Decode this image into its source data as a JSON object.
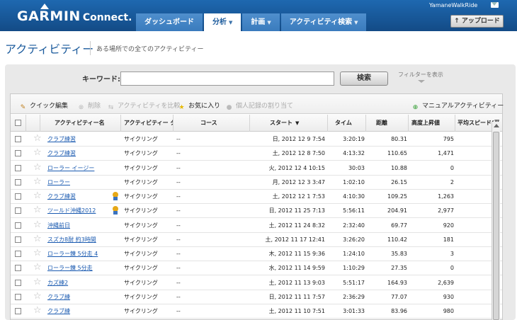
{
  "header": {
    "brand": "GARMIN",
    "brand_sub": "Connect.",
    "user_name": "YamaneWalkRide",
    "upload_label": "アップロード",
    "nav": [
      {
        "label": "ダッシュボード",
        "caret": ""
      },
      {
        "label": "分析",
        "caret": "▼"
      },
      {
        "label": "計画",
        "caret": "▼"
      },
      {
        "label": "アクティビティ検索",
        "caret": "▼"
      }
    ]
  },
  "page": {
    "title": "アクティビティー",
    "subtitle": "ある場所での全てのアクティビティー"
  },
  "search": {
    "keyword_label": "キーワード:",
    "keyword_value": "",
    "search_button": "検索",
    "filter_label": "フィルターを表示"
  },
  "toolbar": {
    "quick_edit": "クイック編集",
    "delete": "削除",
    "compare": "アクティビティを比較",
    "favorite": "お気に入り",
    "personal_record": "個人記録の割り当て",
    "manual_activity": "マニュアルアクティビティー"
  },
  "columns": {
    "name": "アクティビティー名",
    "type": "アクティビティー タ",
    "course": "コース",
    "start": "スタート",
    "start_sort": "▼",
    "time": "タイム",
    "distance": "距離",
    "elevation": "高度上昇値",
    "avg_speed": "平均スピード(平"
  },
  "rows": [
    {
      "name": "クラブ練習",
      "medal": false,
      "type": "サイクリング",
      "course": "--",
      "start": "日, 2012 12 9 7:54",
      "time": "3:20:19",
      "distance": "80.31",
      "elevation": "795"
    },
    {
      "name": "クラブ練習",
      "medal": false,
      "type": "サイクリング",
      "course": "--",
      "start": "土, 2012 12 8 7:50",
      "time": "4:13:32",
      "distance": "110.65",
      "elevation": "1,471"
    },
    {
      "name": "ローラー イージー",
      "medal": false,
      "type": "サイクリング",
      "course": "--",
      "start": "火, 2012 12 4 10:15",
      "time": "30:03",
      "distance": "10.88",
      "elevation": "0"
    },
    {
      "name": "ローラー",
      "medal": false,
      "type": "サイクリング",
      "course": "--",
      "start": "月, 2012 12 3 3:47",
      "time": "1:02:10",
      "distance": "26.15",
      "elevation": "2"
    },
    {
      "name": "クラブ練習",
      "medal": true,
      "type": "サイクリング",
      "course": "--",
      "start": "土, 2012 12 1 7:53",
      "time": "4:10:30",
      "distance": "109.25",
      "elevation": "1,263"
    },
    {
      "name": "ツールド沖縄2012",
      "medal": true,
      "type": "サイクリング",
      "course": "--",
      "start": "日, 2012 11 25 7:13",
      "time": "5:56:11",
      "distance": "204.91",
      "elevation": "2,977"
    },
    {
      "name": "沖縄前日",
      "medal": false,
      "type": "サイクリング",
      "course": "--",
      "start": "土, 2012 11 24 8:32",
      "time": "2:32:40",
      "distance": "69.77",
      "elevation": "920"
    },
    {
      "name": "スズカ8耐 約3時間",
      "medal": false,
      "type": "サイクリング",
      "course": "--",
      "start": "土, 2012 11 17 12:41",
      "time": "3:26:20",
      "distance": "110.42",
      "elevation": "181"
    },
    {
      "name": "ローラー錬 5分走 4",
      "medal": false,
      "type": "サイクリング",
      "course": "--",
      "start": "木, 2012 11 15 9:36",
      "time": "1:24:10",
      "distance": "35.83",
      "elevation": "3"
    },
    {
      "name": "ローラー錬 5分走",
      "medal": false,
      "type": "サイクリング",
      "course": "--",
      "start": "水, 2012 11 14 9:59",
      "time": "1:10:29",
      "distance": "27.35",
      "elevation": "0"
    },
    {
      "name": "カズ練2",
      "medal": false,
      "type": "サイクリング",
      "course": "--",
      "start": "土, 2012 11 13 9:03",
      "time": "5:51:17",
      "distance": "164.93",
      "elevation": "2,639"
    },
    {
      "name": "クラブ練",
      "medal": false,
      "type": "サイクリング",
      "course": "--",
      "start": "日, 2012 11 11 7:57",
      "time": "2:36:29",
      "distance": "77.07",
      "elevation": "930"
    },
    {
      "name": "クラブ練",
      "medal": false,
      "type": "サイクリング",
      "course": "--",
      "start": "土, 2012 11 10 7:51",
      "time": "3:01:33",
      "distance": "83.96",
      "elevation": "980"
    }
  ],
  "colors": {
    "header": "#1a5a9c",
    "link": "#1a5ab0"
  }
}
